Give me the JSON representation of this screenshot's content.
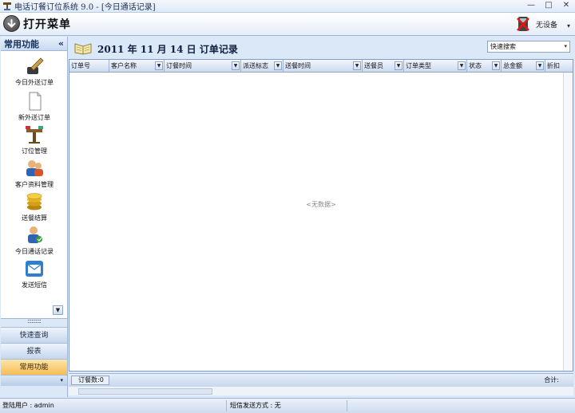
{
  "window": {
    "title": "电话订餐订位系统 9.0 - [今日通话记录]",
    "minimize": "—",
    "maximize": "□",
    "close": "✕"
  },
  "header": {
    "menu_label": "打开菜单",
    "device_label": "无设备",
    "dropdown_arrow": "▾"
  },
  "sidebar": {
    "title": "常用功能",
    "collapse": "«",
    "items": [
      {
        "label": "今日外送订单",
        "icon": "pen-ink-icon"
      },
      {
        "label": "新外送订单",
        "icon": "blank-page-icon"
      },
      {
        "label": "订位管理",
        "icon": "table-seat-icon"
      },
      {
        "label": "客户资料管理",
        "icon": "customers-icon"
      },
      {
        "label": "送餐结算",
        "icon": "coins-icon"
      },
      {
        "label": "今日通话记录",
        "icon": "call-log-icon"
      },
      {
        "label": "发送短信",
        "icon": "envelope-icon"
      }
    ],
    "scroll_arrow": "▼",
    "splitter": "::::::::::",
    "nav": [
      {
        "label": "快速查询"
      },
      {
        "label": "报表"
      },
      {
        "label": "常用功能"
      }
    ],
    "nav_arrow": "▾"
  },
  "main": {
    "title": "2011 年 11 月 14 日 订单记录",
    "search": {
      "value": "快速搜索",
      "arrow": "▾"
    },
    "columns": [
      "订单号",
      "客户名称",
      "订餐时间",
      "派送标志",
      "送餐时间",
      "送餐员",
      "订单类型",
      "状态",
      "总金额",
      "折扣"
    ],
    "column_arrow": "▼",
    "empty_text": "<无数据>",
    "order_count": "订餐数:0",
    "total_label": "合计:"
  },
  "status": {
    "user": "登陆用户 : admin",
    "sms": "短信发送方式 : 无"
  },
  "colors": {
    "accent": "#f6bd55",
    "frame": "#dbe8f7",
    "border": "#9fb6d6"
  }
}
